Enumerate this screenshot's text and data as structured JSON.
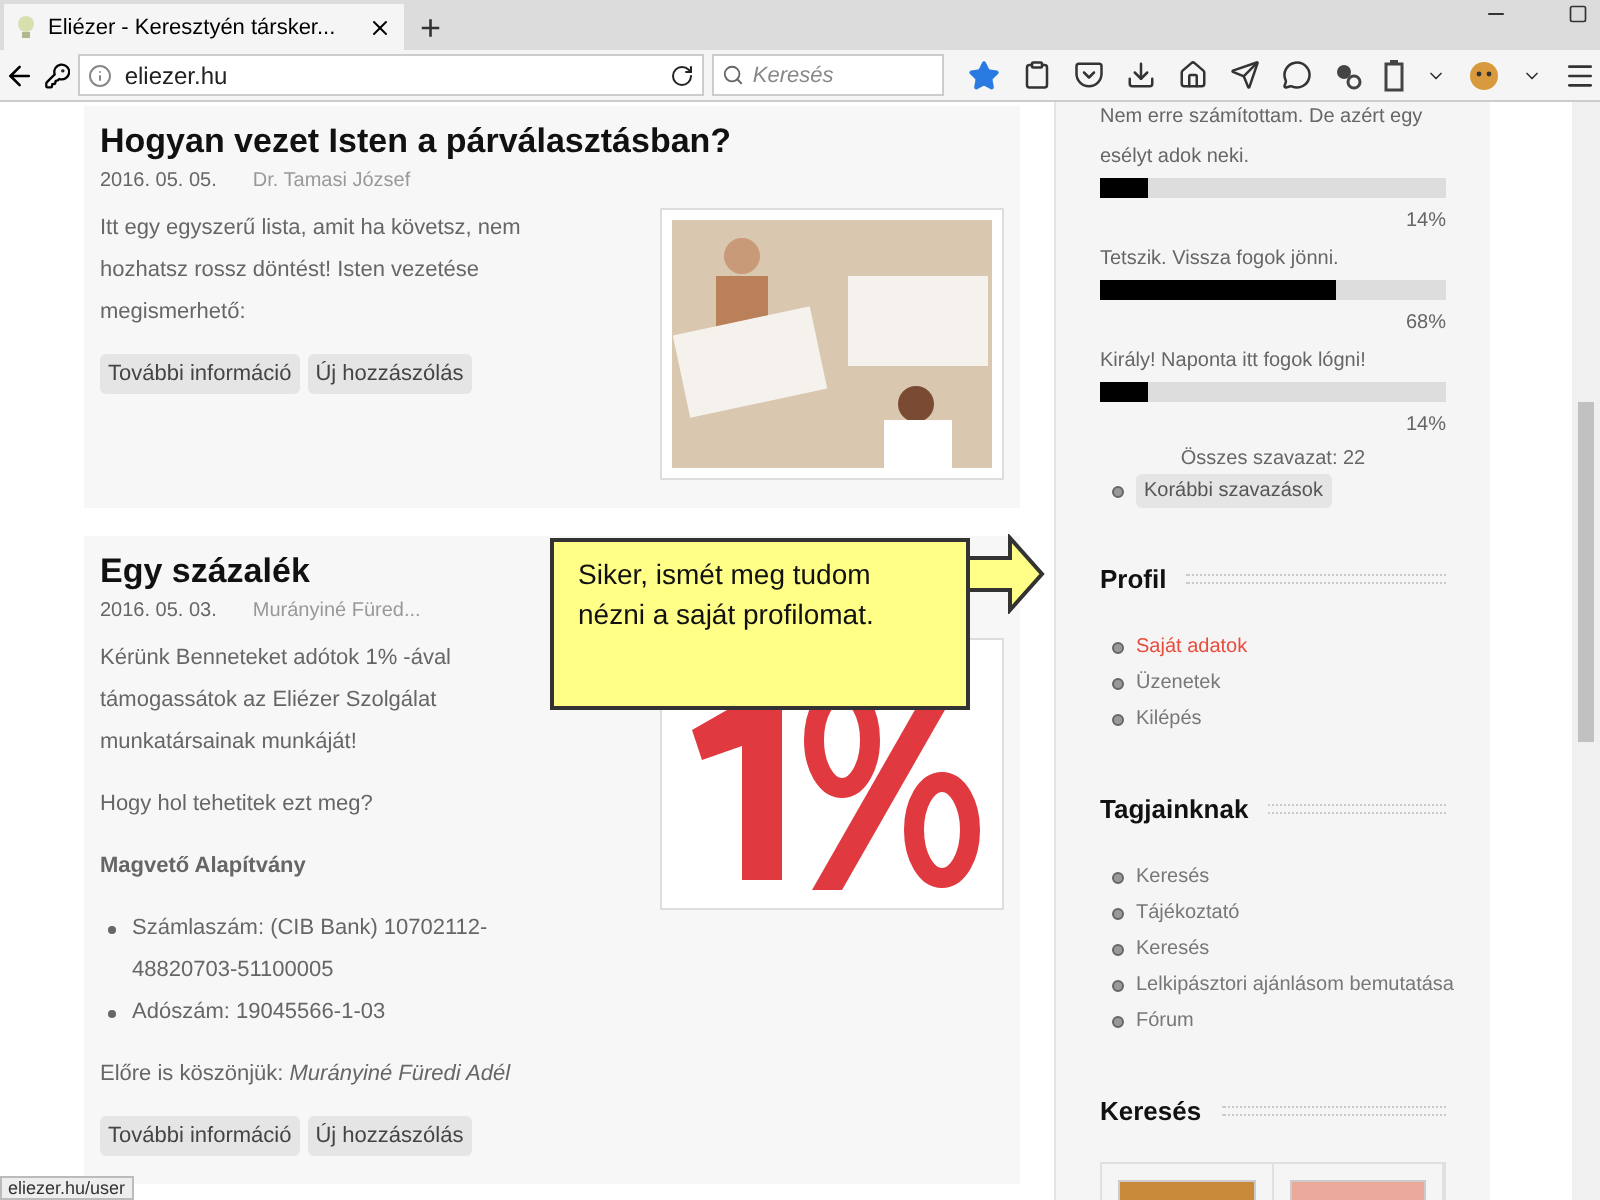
{
  "browser": {
    "tab_title": "Eliézer - Keresztyén társker...",
    "new_tab": "+",
    "address": "eliezer.hu",
    "search_placeholder": "Keresés",
    "bookmarked": true
  },
  "posts": [
    {
      "title": "Hogyan vezet Isten a párválasztásban?",
      "date": "2016. 05. 05.",
      "author": "Dr. Tamasi József",
      "body": [
        {
          "kind": "para",
          "text": "Itt egy egyszerű lista, amit ha követsz, nem hozhatsz rossz döntést! Isten vezetése megismerhető:"
        }
      ],
      "buttons": [
        "További információ",
        "Új hozzászólás"
      ]
    },
    {
      "title": "Egy százalék",
      "date": "2016. 05. 03.",
      "author": "Murányiné Füred...",
      "body": [
        {
          "kind": "para",
          "text": "Kérünk Benneteket adótok 1% -ával támogassátok az Eliézer Szolgálat munkatársainak munkáját!"
        },
        {
          "kind": "para",
          "text": "Hogy hol tehetitek ezt meg?"
        },
        {
          "kind": "strong",
          "text": "Magvető Alapítvány"
        },
        {
          "kind": "list",
          "items": [
            "Számlaszám: (CIB Bank) 10702112-48820703-51100005",
            "Adószám: 19045566-1-03"
          ]
        },
        {
          "kind": "para",
          "text": "Előre is köszönjük: *Murányiné Füredi Adél*"
        }
      ],
      "buttons": [
        "További információ",
        "Új hozzászólás"
      ]
    }
  ],
  "poll": {
    "options": [
      {
        "label": "Nem erre számítottam. De azért egy esélyt adok neki.",
        "level": 0.14,
        "reading": "14%"
      },
      {
        "label": "Tetszik. Vissza fogok jönni.",
        "level": 0.68,
        "reading": "68%"
      },
      {
        "label": "Király! Naponta itt fogok lógni!",
        "level": 0.14,
        "reading": "14%"
      }
    ],
    "total": "Összes szavazat: 22",
    "older": "Korábbi szavazások"
  },
  "sidebar": [
    {
      "title": "Profil",
      "items": [
        {
          "label": "Saját adatok",
          "selected": true
        },
        {
          "label": "Üzenetek",
          "selected": false
        },
        {
          "label": "Kilépés",
          "selected": false
        }
      ]
    },
    {
      "title": "Tagjainknak",
      "items": [
        {
          "label": "Keresés",
          "selected": false
        },
        {
          "label": "Tájékoztató",
          "selected": false
        },
        {
          "label": "Keresés",
          "selected": false
        },
        {
          "label": "Lelkipásztori ajánlásom bemutatása",
          "selected": false
        },
        {
          "label": "Fórum",
          "selected": false
        }
      ]
    },
    {
      "title": "Keresés"
    }
  ],
  "callout": {
    "text": "Siker, ismét meg tudom nézni a saját profilomat."
  },
  "status_bar": {
    "url": "eliezer.hu/user"
  }
}
